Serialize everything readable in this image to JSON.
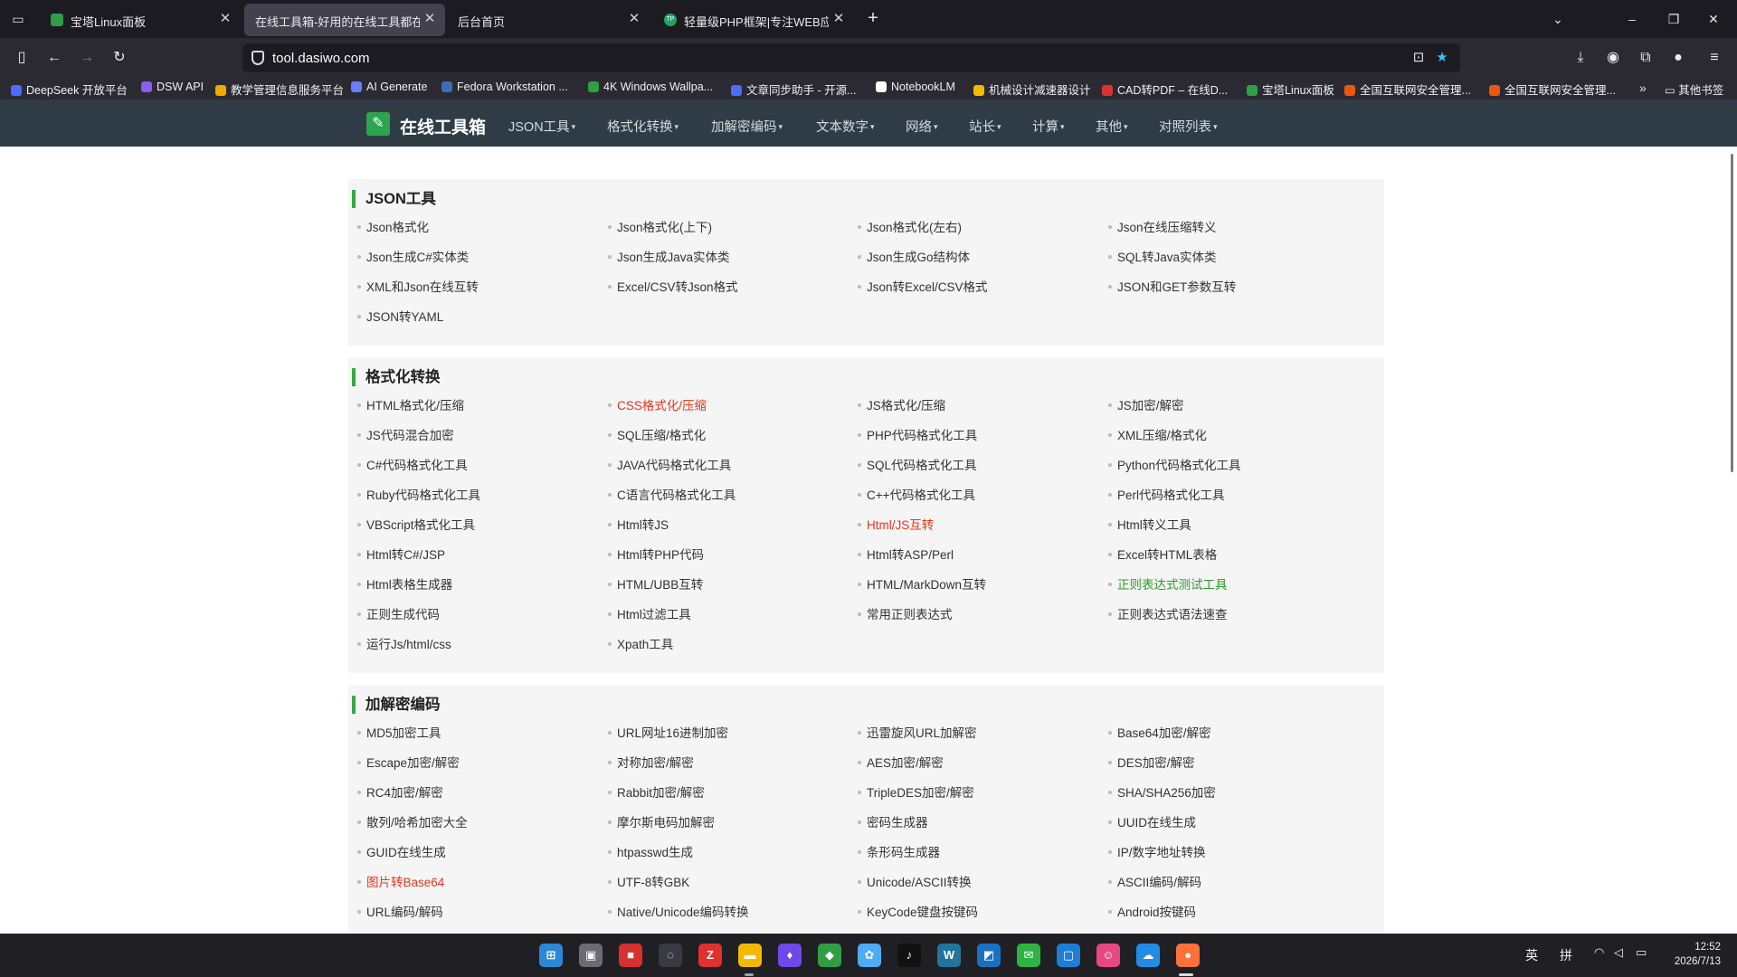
{
  "browser": {
    "tabs": [
      {
        "title": "宝塔Linux面板",
        "icon_color": "#2f9e44"
      },
      {
        "title": "在线工具箱-好用的在线工具都在这",
        "icon_color": "#5a5a66",
        "active": true
      },
      {
        "title": "后台首页",
        "icon_color": "#1c1b22"
      },
      {
        "title": "轻量级PHP框架|专注WEB应用开发",
        "icon_color": "#1fa463",
        "icon_text": "TP"
      }
    ],
    "url": "tool.dasiwo.com",
    "bookmarks": [
      {
        "label": "DeepSeek 开放平台",
        "icon_color": "#4d6bfe"
      },
      {
        "label": "DSW API",
        "icon_color": "#8b5cf6"
      },
      {
        "label": "教学管理信息服务平台",
        "icon_color": "#f2a900"
      },
      {
        "label": "AI Generate",
        "icon_color": "#6b7cff"
      },
      {
        "label": "Fedora Workstation ...",
        "icon_color": "#3c6eb4"
      },
      {
        "label": "4K Windows Wallpa...",
        "icon_color": "#2f9e44"
      },
      {
        "label": "文章同步助手 - 开源...",
        "icon_color": "#4c6ef5"
      },
      {
        "label": "NotebookLM",
        "icon_color": "#ffffff"
      },
      {
        "label": "机械设计减速器设计",
        "icon_color": "#f5b800"
      },
      {
        "label": "CAD转PDF – 在线D...",
        "icon_color": "#e03131"
      },
      {
        "label": "宝塔Linux面板",
        "icon_color": "#2f9e44"
      },
      {
        "label": "全国互联网安全管理...",
        "icon_color": "#e8590c"
      },
      {
        "label": "全国互联网安全管理...",
        "icon_color": "#e8590c"
      }
    ],
    "other_bookmarks": "其他书签"
  },
  "site": {
    "logo": "在线工具箱",
    "menu": [
      "JSON工具",
      "格式化转换",
      "加解密编码",
      "文本数字",
      "网络",
      "站长",
      "计算",
      "其他",
      "对照列表"
    ]
  },
  "sections": [
    {
      "title": "JSON工具",
      "links": [
        {
          "label": "Json格式化"
        },
        {
          "label": "Json格式化(上下)"
        },
        {
          "label": "Json格式化(左右)"
        },
        {
          "label": "Json在线压缩转义"
        },
        {
          "label": "Json生成C#实体类"
        },
        {
          "label": "Json生成Java实体类"
        },
        {
          "label": "Json生成Go结构体"
        },
        {
          "label": "SQL转Java实体类"
        },
        {
          "label": "XML和Json在线互转"
        },
        {
          "label": "Excel/CSV转Json格式"
        },
        {
          "label": "Json转Excel/CSV格式"
        },
        {
          "label": "JSON和GET参数互转"
        },
        {
          "label": "JSON转YAML"
        }
      ]
    },
    {
      "title": "格式化转换",
      "links": [
        {
          "label": "HTML格式化/压缩"
        },
        {
          "label": "CSS格式化/压缩",
          "color": "red"
        },
        {
          "label": "JS格式化/压缩"
        },
        {
          "label": "JS加密/解密"
        },
        {
          "label": "JS代码混合加密"
        },
        {
          "label": "SQL压缩/格式化"
        },
        {
          "label": "PHP代码格式化工具"
        },
        {
          "label": "XML压缩/格式化"
        },
        {
          "label": "C#代码格式化工具"
        },
        {
          "label": "JAVA代码格式化工具"
        },
        {
          "label": "SQL代码格式化工具"
        },
        {
          "label": "Python代码格式化工具"
        },
        {
          "label": "Ruby代码格式化工具"
        },
        {
          "label": "C语言代码格式化工具"
        },
        {
          "label": "C++代码格式化工具"
        },
        {
          "label": "Perl代码格式化工具"
        },
        {
          "label": "VBScript格式化工具"
        },
        {
          "label": "Html转JS"
        },
        {
          "label": "Html/JS互转",
          "color": "red"
        },
        {
          "label": "Html转义工具"
        },
        {
          "label": "Html转C#/JSP"
        },
        {
          "label": "Html转PHP代码"
        },
        {
          "label": "Html转ASP/Perl"
        },
        {
          "label": "Excel转HTML表格"
        },
        {
          "label": "Html表格生成器"
        },
        {
          "label": "HTML/UBB互转"
        },
        {
          "label": "HTML/MarkDown互转"
        },
        {
          "label": "正则表达式测试工具",
          "color": "green"
        },
        {
          "label": "正则生成代码"
        },
        {
          "label": "Html过滤工具"
        },
        {
          "label": "常用正则表达式"
        },
        {
          "label": "正则表达式语法速查"
        },
        {
          "label": "运行Js/html/css"
        },
        {
          "label": "Xpath工具"
        }
      ]
    },
    {
      "title": "加解密编码",
      "links": [
        {
          "label": "MD5加密工具"
        },
        {
          "label": "URL网址16进制加密"
        },
        {
          "label": "迅雷旋风URL加解密"
        },
        {
          "label": "Base64加密/解密"
        },
        {
          "label": "Escape加密/解密"
        },
        {
          "label": "对称加密/解密"
        },
        {
          "label": "AES加密/解密"
        },
        {
          "label": "DES加密/解密"
        },
        {
          "label": "RC4加密/解密"
        },
        {
          "label": "Rabbit加密/解密"
        },
        {
          "label": "TripleDES加密/解密"
        },
        {
          "label": "SHA/SHA256加密"
        },
        {
          "label": "散列/哈希加密大全"
        },
        {
          "label": "摩尔斯电码加解密"
        },
        {
          "label": "密码生成器"
        },
        {
          "label": "UUID在线生成"
        },
        {
          "label": "GUID在线生成"
        },
        {
          "label": "htpasswd生成"
        },
        {
          "label": "条形码生成器"
        },
        {
          "label": "IP/数字地址转换"
        },
        {
          "label": "图片转Base64",
          "color": "red"
        },
        {
          "label": "UTF-8转GBK"
        },
        {
          "label": "Unicode/ASCII转换"
        },
        {
          "label": "ASCII编码/解码"
        },
        {
          "label": "URL编码/解码"
        },
        {
          "label": "Native/Unicode编码转换"
        },
        {
          "label": "KeyCode键盘按键码"
        },
        {
          "label": "Android按键码"
        }
      ]
    }
  ],
  "taskbar": {
    "apps": [
      {
        "name": "start",
        "color": "#2b88d8",
        "glyph": "⊞"
      },
      {
        "name": "task-view",
        "color": "#6b6b75",
        "glyph": "▣"
      },
      {
        "name": "app-red",
        "color": "#d63031",
        "glyph": "■"
      },
      {
        "name": "app-circle",
        "color": "#3a3a44",
        "glyph": "◌"
      },
      {
        "name": "app-z",
        "color": "#e03131",
        "glyph": "Z"
      },
      {
        "name": "file-explorer",
        "color": "#f5b800",
        "glyph": "▬"
      },
      {
        "name": "app-purple",
        "color": "#7048e8",
        "glyph": "♦"
      },
      {
        "name": "bt-panel",
        "color": "#2f9e44",
        "glyph": "◆"
      },
      {
        "name": "app-cloud",
        "color": "#4dabf7",
        "glyph": "✿"
      },
      {
        "name": "tiktok",
        "color": "#111111",
        "glyph": "♪"
      },
      {
        "name": "wordpress",
        "color": "#21759b",
        "glyph": "W"
      },
      {
        "name": "app-blue",
        "color": "#1971c2",
        "glyph": "◩"
      },
      {
        "name": "wechat",
        "color": "#2fb344",
        "glyph": "✉"
      },
      {
        "name": "app-orange",
        "color": "#1c7ed6",
        "glyph": "▢"
      },
      {
        "name": "app-avatar",
        "color": "#e64980",
        "glyph": "☺"
      },
      {
        "name": "app-cloud2",
        "color": "#228be6",
        "glyph": "☁"
      },
      {
        "name": "firefox",
        "color": "#ff7139",
        "glyph": "●"
      }
    ],
    "ime_lang": "英",
    "ime_mode": "拼",
    "time": "12:52",
    "date": "2026/7/13"
  }
}
